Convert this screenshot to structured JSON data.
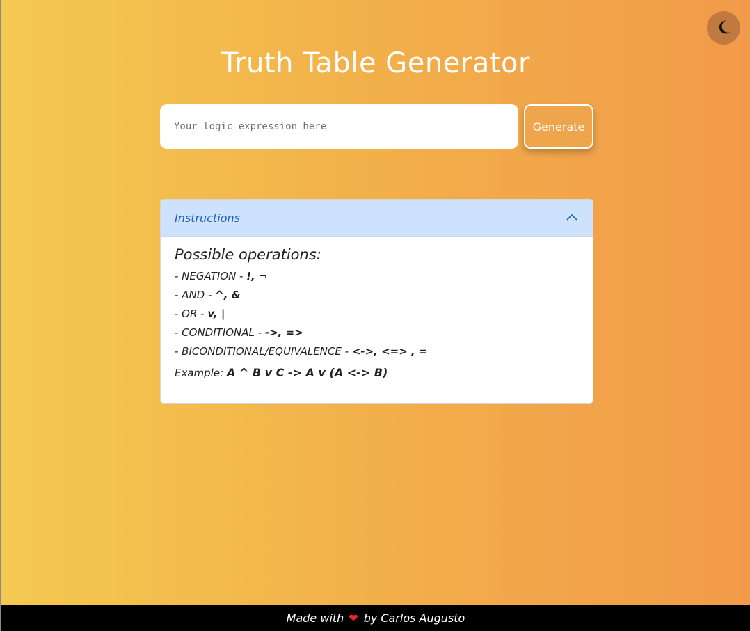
{
  "header": {
    "title": "Truth Table Generator",
    "theme_toggle_icon": "moon-icon"
  },
  "form": {
    "input_placeholder": "Your logic expression here",
    "input_value": "",
    "generate_label": "Generate"
  },
  "instructions": {
    "title": "Instructions",
    "expanded": true,
    "heading": "Possible operations",
    "heading_suffix": ":",
    "operations": [
      {
        "prefix": "- NEGATION - ",
        "symbols": "!, ¬"
      },
      {
        "prefix": "- AND - ",
        "symbols": "^, &"
      },
      {
        "prefix": "- OR - ",
        "symbols": "v, |"
      },
      {
        "prefix": "- CONDITIONAL - ",
        "symbols": "->, =>"
      },
      {
        "prefix": "- BICONDITIONAL/EQUIVALENCE - ",
        "symbols": "<->, <=> , ="
      }
    ],
    "example_label": "Example",
    "example_sep": ": ",
    "example_expr": "A ^ B v C -> A v (A <-> B)"
  },
  "footer": {
    "made_with": "Made with",
    "heart_icon": "heart-icon",
    "by": "by",
    "author": "Carlos Augusto"
  },
  "colors": {
    "gradient_start": "#f4c951",
    "gradient_end": "#f29a4a",
    "instructions_header_bg": "#cfe2fd",
    "instructions_header_text": "#1f5fb8",
    "footer_bg": "#000000",
    "heart": "#e8262e"
  }
}
